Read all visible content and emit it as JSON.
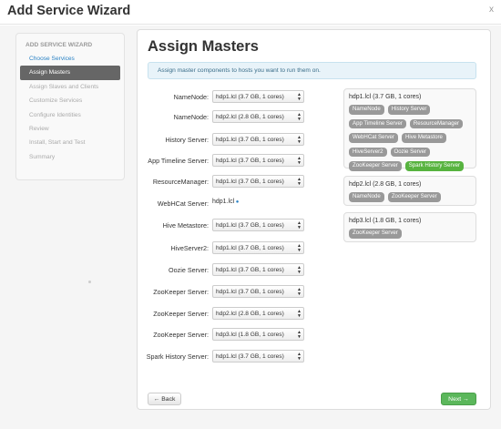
{
  "wizard": {
    "title": "Add Service Wizard",
    "close_label": "x"
  },
  "sidebar": {
    "heading": "ADD SERVICE WIZARD",
    "items": [
      {
        "label": "Choose Services",
        "state": "done"
      },
      {
        "label": "Assign Masters",
        "state": "active"
      },
      {
        "label": "Assign Slaves and Clients",
        "state": "disabled"
      },
      {
        "label": "Customize Services",
        "state": "disabled"
      },
      {
        "label": "Configure Identities",
        "state": "disabled"
      },
      {
        "label": "Review",
        "state": "disabled"
      },
      {
        "label": "Install, Start and Test",
        "state": "disabled"
      },
      {
        "label": "Summary",
        "state": "disabled"
      }
    ]
  },
  "main": {
    "title": "Assign Masters",
    "info": "Assign master components to hosts you want to run them on.",
    "assignments": [
      {
        "label": "NameNode:",
        "value": "hdp1.lcl (3.7 GB, 1 cores)"
      },
      {
        "label": "NameNode:",
        "value": "hdp2.lcl (2.8 GB, 1 cores)"
      },
      {
        "label": "History Server:",
        "value": "hdp1.lcl (3.7 GB, 1 cores)"
      },
      {
        "label": "App Timeline Server:",
        "value": "hdp1.lcl (3.7 GB, 1 cores)"
      },
      {
        "label": "ResourceManager:",
        "value": "hdp1.lcl (3.7 GB, 1 cores)"
      },
      {
        "label": "WebHCat Server:",
        "value": "hdp1.lcl"
      },
      {
        "label": "Hive Metastore:",
        "value": "hdp1.lcl (3.7 GB, 1 cores)"
      },
      {
        "label": "HiveServer2:",
        "value": "hdp1.lcl (3.7 GB, 1 cores)"
      },
      {
        "label": "Oozie Server:",
        "value": "hdp1.lcl (3.7 GB, 1 cores)"
      },
      {
        "label": "ZooKeeper Server:",
        "value": "hdp1.lcl (3.7 GB, 1 cores)"
      },
      {
        "label": "ZooKeeper Server:",
        "value": "hdp2.lcl (2.8 GB, 1 cores)"
      },
      {
        "label": "ZooKeeper Server:",
        "value": "hdp3.lcl (1.8 GB, 1 cores)"
      },
      {
        "label": "Spark History Server:",
        "value": "hdp1.lcl (3.7 GB, 1 cores)"
      }
    ],
    "hosts": [
      {
        "name": "hdp1.lcl (3.7 GB, 1 cores)",
        "components": [
          {
            "label": "NameNode",
            "new": false
          },
          {
            "label": "History Server",
            "new": false
          },
          {
            "label": "App Timeline Server",
            "new": false
          },
          {
            "label": "ResourceManager",
            "new": false
          },
          {
            "label": "WebHCat Server",
            "new": false
          },
          {
            "label": "Hive Metastore",
            "new": false
          },
          {
            "label": "HiveServer2",
            "new": false
          },
          {
            "label": "Oozie Server",
            "new": false
          },
          {
            "label": "ZooKeeper Server",
            "new": false
          },
          {
            "label": "Spark History Server",
            "new": true
          }
        ]
      },
      {
        "name": "hdp2.lcl (2.8 GB, 1 cores)",
        "components": [
          {
            "label": "NameNode",
            "new": false
          },
          {
            "label": "ZooKeeper Server",
            "new": false
          }
        ]
      },
      {
        "name": "hdp3.lcl (1.8 GB, 1 cores)",
        "components": [
          {
            "label": "ZooKeeper Server",
            "new": false
          }
        ]
      }
    ],
    "back_label": "← Back",
    "next_label": "Next →"
  },
  "colors": {
    "accent": "#2a82c5",
    "success": "#5bb75b",
    "badge": "#999999",
    "badge_new": "#57b33f"
  }
}
